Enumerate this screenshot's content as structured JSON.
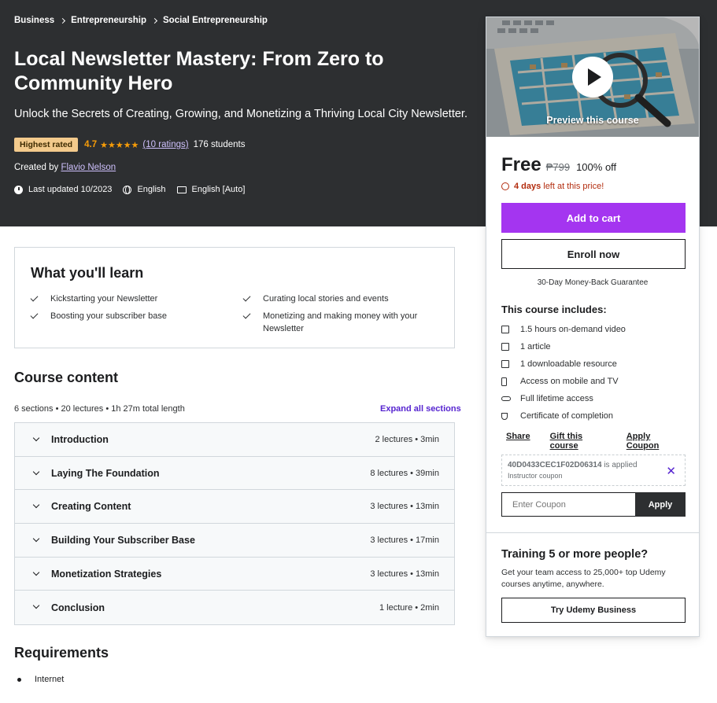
{
  "breadcrumb": [
    "Business",
    "Entrepreneurship",
    "Social Entrepreneurship"
  ],
  "course": {
    "title": "Local Newsletter Mastery: From Zero to Community Hero",
    "subtitle": "Unlock the Secrets of Creating, Growing, and Monetizing a Thriving Local City Newsletter.",
    "badge": "Highest rated",
    "rating": "4.7",
    "stars": "★★★★★",
    "ratings_link": "(10 ratings)",
    "students": "176 students",
    "created_by_label": "Created by",
    "instructor": "Flavio Nelson",
    "last_updated": "Last updated 10/2023",
    "language": "English",
    "captions": "English [Auto]"
  },
  "learn": {
    "title": "What you'll learn",
    "items": [
      "Kickstarting your Newsletter",
      "Curating local stories and events",
      "Boosting your subscriber base",
      "Monetizing and making money with your Newsletter"
    ]
  },
  "content": {
    "title": "Course content",
    "summary": "6 sections • 20 lectures • 1h 27m total length",
    "expand_label": "Expand all sections",
    "sections": [
      {
        "title": "Introduction",
        "meta": "2 lectures • 3min"
      },
      {
        "title": "Laying The Foundation",
        "meta": "8 lectures • 39min"
      },
      {
        "title": "Creating Content",
        "meta": "3 lectures • 13min"
      },
      {
        "title": "Building Your Subscriber Base",
        "meta": "3 lectures • 17min"
      },
      {
        "title": "Monetization Strategies",
        "meta": "3 lectures • 13min"
      },
      {
        "title": "Conclusion",
        "meta": "1 lecture • 2min"
      }
    ]
  },
  "requirements": {
    "title": "Requirements",
    "items": [
      "Internet"
    ]
  },
  "sidebar": {
    "preview_label": "Preview this course",
    "price": "Free",
    "original_price": "₱799",
    "discount": "100% off",
    "timer_days": "4 days",
    "timer_rest": "left at this price!",
    "add_to_cart": "Add to cart",
    "enroll": "Enroll now",
    "guarantee": "30-Day Money-Back Guarantee",
    "includes_title": "This course includes:",
    "includes": [
      "1.5 hours on-demand video",
      "1 article",
      "1 downloadable resource",
      "Access on mobile and TV",
      "Full lifetime access",
      "Certificate of completion"
    ],
    "links": [
      "Share",
      "Gift this course",
      "Apply Coupon"
    ],
    "coupon_code": "40D0433CEC1F02D06314",
    "coupon_applied": "is applied",
    "coupon_type": "Instructor coupon",
    "coupon_placeholder": "Enter Coupon",
    "coupon_apply": "Apply",
    "team_title": "Training 5 or more people?",
    "team_desc": "Get your team access to 25,000+ top Udemy courses anytime, anywhere.",
    "business_button": "Try Udemy Business"
  },
  "colors": {
    "hero_bg": "#2d2f31",
    "primary_purple": "#a435f0",
    "link_purple": "#5624d0",
    "star": "#f69c08",
    "badge": "#f3ca8c",
    "timer_red": "#b32d0f"
  }
}
